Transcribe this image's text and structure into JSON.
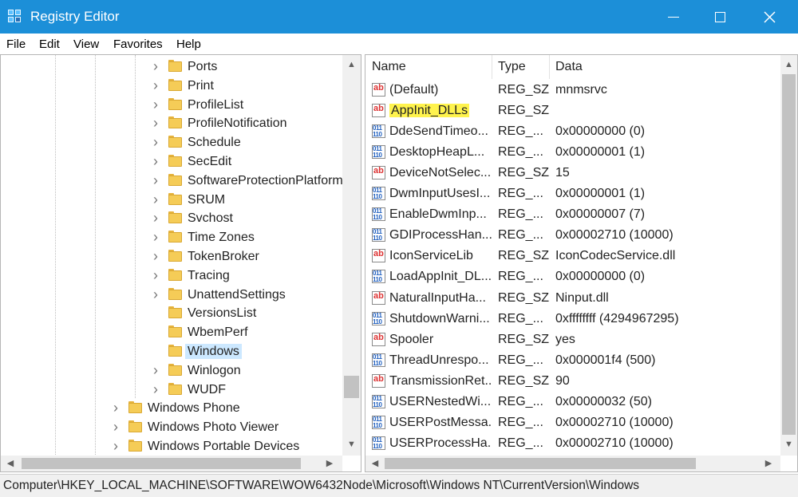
{
  "window": {
    "title": "Registry Editor",
    "controls": {
      "minimize": "minimize",
      "maximize": "maximize",
      "close": "close"
    }
  },
  "menu": [
    "File",
    "Edit",
    "View",
    "Favorites",
    "Help"
  ],
  "tree": {
    "items": [
      {
        "label": "Ports",
        "level": 2,
        "expandable": true
      },
      {
        "label": "Print",
        "level": 2,
        "expandable": true
      },
      {
        "label": "ProfileList",
        "level": 2,
        "expandable": true
      },
      {
        "label": "ProfileNotification",
        "level": 2,
        "expandable": true
      },
      {
        "label": "Schedule",
        "level": 2,
        "expandable": true
      },
      {
        "label": "SecEdit",
        "level": 2,
        "expandable": true
      },
      {
        "label": "SoftwareProtectionPlatform",
        "level": 2,
        "expandable": true
      },
      {
        "label": "SRUM",
        "level": 2,
        "expandable": true
      },
      {
        "label": "Svchost",
        "level": 2,
        "expandable": true
      },
      {
        "label": "Time Zones",
        "level": 2,
        "expandable": true
      },
      {
        "label": "TokenBroker",
        "level": 2,
        "expandable": true
      },
      {
        "label": "Tracing",
        "level": 2,
        "expandable": true
      },
      {
        "label": "UnattendSettings",
        "level": 2,
        "expandable": true
      },
      {
        "label": "VersionsList",
        "level": 2,
        "expandable": false
      },
      {
        "label": "WbemPerf",
        "level": 2,
        "expandable": false
      },
      {
        "label": "Windows",
        "level": 2,
        "expandable": false,
        "selected": true
      },
      {
        "label": "Winlogon",
        "level": 2,
        "expandable": true
      },
      {
        "label": "WUDF",
        "level": 2,
        "expandable": true
      },
      {
        "label": "Windows Phone",
        "level": 1,
        "expandable": true
      },
      {
        "label": "Windows Photo Viewer",
        "level": 1,
        "expandable": true
      },
      {
        "label": "Windows Portable Devices",
        "level": 1,
        "expandable": true
      }
    ]
  },
  "list": {
    "columns": {
      "name": "Name",
      "type": "Type",
      "data": "Data"
    },
    "rows": [
      {
        "icon": "sz",
        "name": "(Default)",
        "type": "REG_SZ",
        "data": "mnmsrvc"
      },
      {
        "icon": "sz",
        "name": "AppInit_DLLs",
        "type": "REG_SZ",
        "data": "",
        "highlighted": true
      },
      {
        "icon": "bin",
        "name": "DdeSendTimeo...",
        "type": "REG_...",
        "data": "0x00000000 (0)"
      },
      {
        "icon": "bin",
        "name": "DesktopHeapL...",
        "type": "REG_...",
        "data": "0x00000001 (1)"
      },
      {
        "icon": "sz",
        "name": "DeviceNotSelec...",
        "type": "REG_SZ",
        "data": "15"
      },
      {
        "icon": "bin",
        "name": "DwmInputUsesI...",
        "type": "REG_...",
        "data": "0x00000001 (1)"
      },
      {
        "icon": "bin",
        "name": "EnableDwmInp...",
        "type": "REG_...",
        "data": "0x00000007 (7)"
      },
      {
        "icon": "bin",
        "name": "GDIProcessHan...",
        "type": "REG_...",
        "data": "0x00002710 (10000)"
      },
      {
        "icon": "sz",
        "name": "IconServiceLib",
        "type": "REG_SZ",
        "data": "IconCodecService.dll"
      },
      {
        "icon": "bin",
        "name": "LoadAppInit_DL...",
        "type": "REG_...",
        "data": "0x00000000 (0)"
      },
      {
        "icon": "sz",
        "name": "NaturalInputHa...",
        "type": "REG_SZ",
        "data": "Ninput.dll"
      },
      {
        "icon": "bin",
        "name": "ShutdownWarni...",
        "type": "REG_...",
        "data": "0xffffffff (4294967295)"
      },
      {
        "icon": "sz",
        "name": "Spooler",
        "type": "REG_SZ",
        "data": "yes"
      },
      {
        "icon": "bin",
        "name": "ThreadUnrespo...",
        "type": "REG_...",
        "data": "0x000001f4 (500)"
      },
      {
        "icon": "sz",
        "name": "TransmissionRet...",
        "type": "REG_SZ",
        "data": "90"
      },
      {
        "icon": "bin",
        "name": "USERNestedWi...",
        "type": "REG_...",
        "data": "0x00000032 (50)"
      },
      {
        "icon": "bin",
        "name": "USERPostMessa...",
        "type": "REG_...",
        "data": "0x00002710 (10000)"
      },
      {
        "icon": "bin",
        "name": "USERProcessHa...",
        "type": "REG_...",
        "data": "0x00002710 (10000)"
      }
    ]
  },
  "status": {
    "path": "Computer\\HKEY_LOCAL_MACHINE\\SOFTWARE\\WOW6432Node\\Microsoft\\Windows NT\\CurrentVersion\\Windows"
  },
  "icons": {
    "app": "registry-editor-icon",
    "folder": "folder-icon",
    "string_value": "string-value-icon",
    "binary_value": "binary-value-icon"
  },
  "colors": {
    "titlebar": "#1c8fd8",
    "selection": "#cce8ff",
    "highlight": "#fff34d",
    "folder": "#f5cc57"
  }
}
